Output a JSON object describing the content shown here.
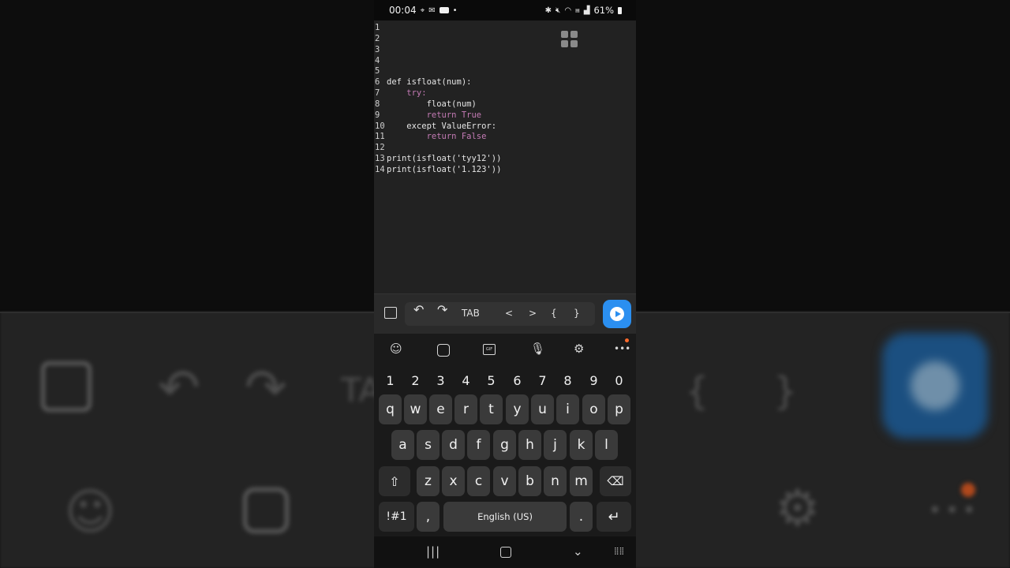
{
  "status_bar": {
    "time": "00:04",
    "battery": "61%",
    "icons_left": [
      "location-icon",
      "mail-icon",
      "youtube-icon",
      "dot-icon"
    ],
    "icons_right": [
      "bluetooth-icon",
      "mute-icon",
      "wifi-icon",
      "volte-icon",
      "signal-icon",
      "battery-icon"
    ]
  },
  "editor": {
    "lines": [
      {
        "n": "1",
        "code": ""
      },
      {
        "n": "2",
        "code": ""
      },
      {
        "n": "3",
        "code": ""
      },
      {
        "n": "4",
        "code": ""
      },
      {
        "n": "5",
        "code": ""
      },
      {
        "n": "6",
        "code": "def isfloat(num):"
      },
      {
        "n": "7",
        "code": "    try:"
      },
      {
        "n": "8",
        "code": "        float(num)"
      },
      {
        "n": "9",
        "code": "        return True"
      },
      {
        "n": "10",
        "code": "    except ValueError:"
      },
      {
        "n": "11",
        "code": "        return False"
      },
      {
        "n": "12",
        "code": ""
      },
      {
        "n": "13",
        "code": "print(isfloat('tyy12'))"
      },
      {
        "n": "14",
        "code": "print(isfloat('1.123'))"
      }
    ]
  },
  "toolbar": {
    "tab_label": "TAB",
    "lt": "<",
    "gt": ">",
    "lbrace": "{",
    "rbrace": "}"
  },
  "keyboard": {
    "number_row": [
      "1",
      "2",
      "3",
      "4",
      "5",
      "6",
      "7",
      "8",
      "9",
      "0"
    ],
    "row1": [
      "q",
      "w",
      "e",
      "r",
      "t",
      "y",
      "u",
      "i",
      "o",
      "p"
    ],
    "row2": [
      "a",
      "s",
      "d",
      "f",
      "g",
      "h",
      "j",
      "k",
      "l"
    ],
    "row3": [
      "z",
      "x",
      "c",
      "v",
      "b",
      "n",
      "m"
    ],
    "sym_key": "!#1",
    "comma": ",",
    "space_label": "English (US)",
    "period": "."
  },
  "background": {
    "tab_label": "TA",
    "lbrace": "{",
    "rbrace": "}"
  },
  "colors": {
    "accent": "#2b8ff0",
    "keyword": "#c978b3",
    "builtin": "#6fa4d6",
    "string": "#e04c6c",
    "notification_dot": "#ff6a2b"
  }
}
